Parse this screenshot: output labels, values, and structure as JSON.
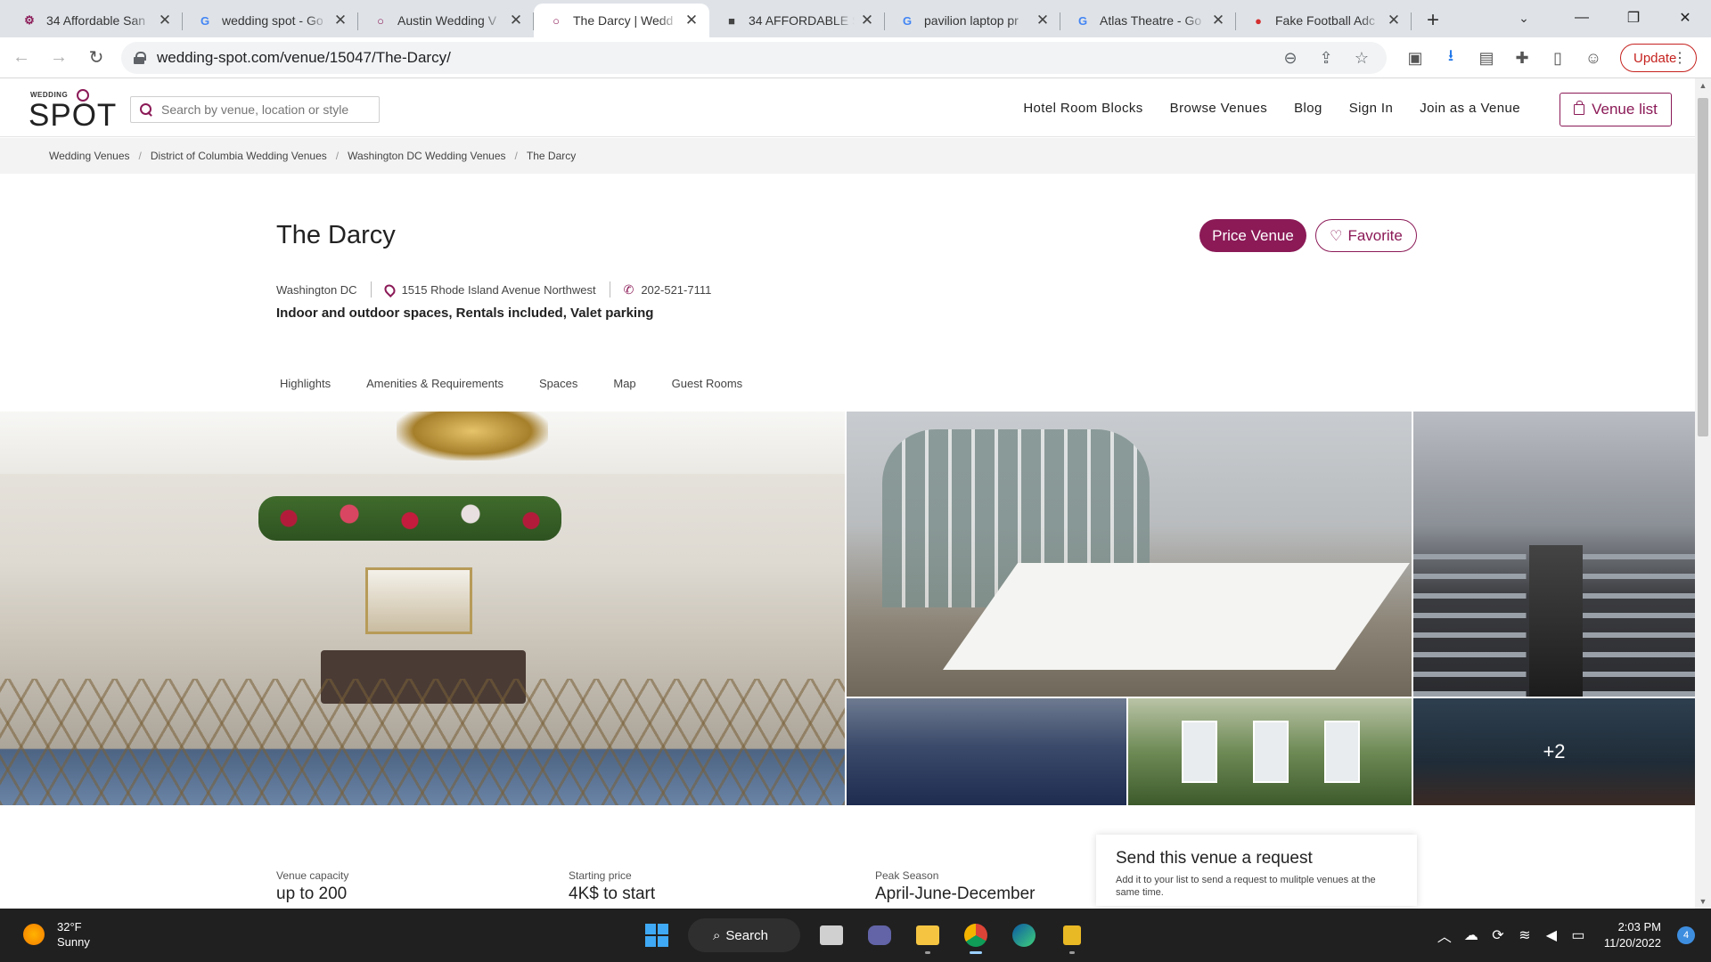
{
  "browser": {
    "tabs": [
      {
        "title": "34 Affordable San",
        "favicon": "gear-favicon",
        "active": false
      },
      {
        "title": "wedding spot - Go",
        "favicon": "google-favicon",
        "active": false
      },
      {
        "title": "Austin Wedding V",
        "favicon": "ring-favicon",
        "active": false
      },
      {
        "title": "The Darcy | Wedd",
        "favicon": "ring-favicon",
        "active": true
      },
      {
        "title": "34 AFFORDABLE S",
        "favicon": "cube-favicon",
        "active": false
      },
      {
        "title": "pavilion laptop pr",
        "favicon": "google-favicon",
        "active": false
      },
      {
        "title": "Atlas Theatre - Go",
        "favicon": "google-favicon",
        "active": false
      },
      {
        "title": "Fake Football Adc",
        "favicon": "red-favicon",
        "active": false
      }
    ],
    "new_tab": "+",
    "url": "wedding-spot.com/venue/15047/The-Darcy/",
    "update_label": "Update"
  },
  "site": {
    "logo_small": "WEDDING",
    "logo_big": "SPOT",
    "search_placeholder": "Search by venue, location or style",
    "nav": {
      "hotel": "Hotel Room Blocks",
      "browse": "Browse Venues",
      "blog": "Blog",
      "signin": "Sign In",
      "join": "Join as a Venue"
    },
    "venue_list": "Venue list",
    "brand_color": "#8b1a57"
  },
  "breadcrumb": [
    "Wedding Venues",
    "District of Columbia Wedding Venues",
    "Washington DC Wedding Venues",
    "The Darcy"
  ],
  "venue": {
    "name": "The Darcy",
    "price_btn": "Price Venue",
    "favorite_btn": "Favorite",
    "city": "Washington DC",
    "address": "1515 Rhode Island Avenue Northwest",
    "phone": "202-521-7111",
    "features": "Indoor and outdoor spaces, Rentals included, Valet parking",
    "tabs": [
      "Highlights",
      "Amenities & Requirements",
      "Spaces",
      "Map",
      "Guest Rooms"
    ],
    "more_photos": "+2"
  },
  "stats": {
    "capacity_label": "Venue capacity",
    "capacity_value": "up to 200",
    "price_label": "Starting price",
    "price_value": "4K$ to start",
    "season_label": "Peak Season",
    "season_value": "April-June-December"
  },
  "request": {
    "title": "Send this venue a request",
    "subtitle": "Add it to your list to send a request to mulitple venues at the same time."
  },
  "taskbar": {
    "temp": "32°F",
    "condition": "Sunny",
    "search": "Search",
    "time": "2:03 PM",
    "date": "11/20/2022",
    "notifications": "4"
  }
}
